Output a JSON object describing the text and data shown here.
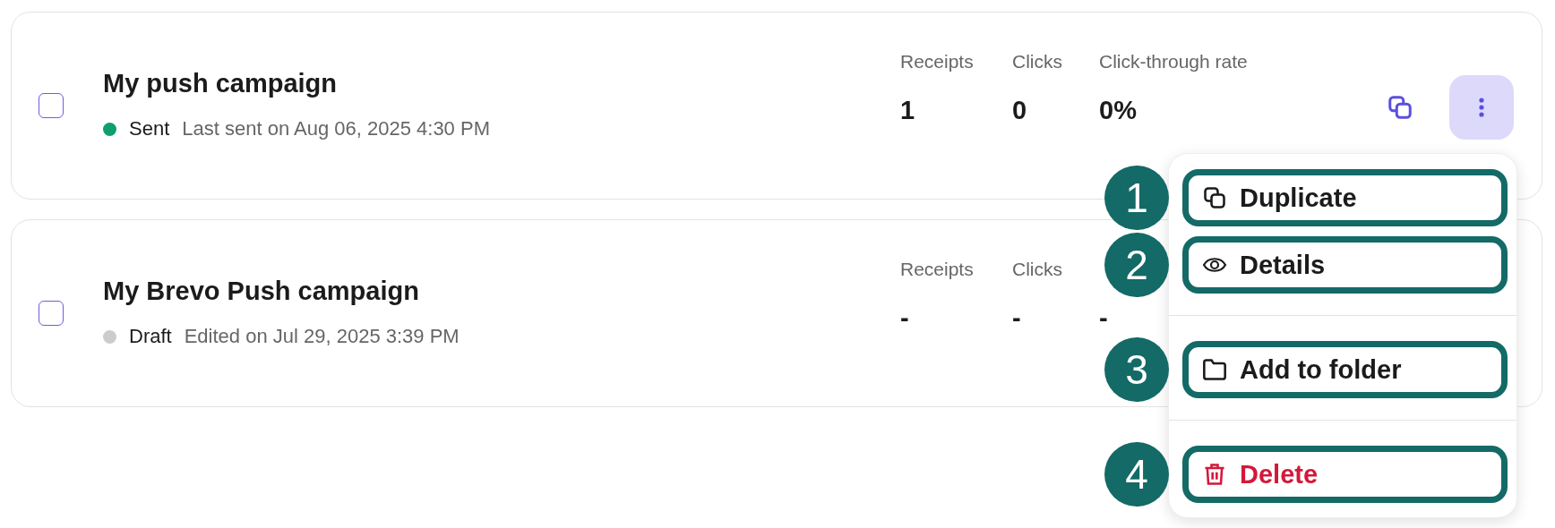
{
  "campaigns": [
    {
      "title": "My push campaign",
      "checked": false,
      "status": "Sent",
      "color": "#0e9f6e",
      "meta": "Last sent on Aug 06, 2025 4:30 PM",
      "stats": [
        {
          "label": "Receipts",
          "value": "1"
        },
        {
          "label": "Clicks",
          "value": "0"
        },
        {
          "label": "Click-through rate",
          "value": "0%"
        }
      ],
      "actions": true,
      "menu_open": true
    },
    {
      "title": "My Brevo Push campaign",
      "checked": false,
      "status": "Draft",
      "color": "#cccccc",
      "meta": "Edited on Jul 29, 2025 3:39 PM",
      "stats": [
        {
          "label": "Receipts",
          "value": "-"
        },
        {
          "label": "Clicks",
          "value": "-"
        },
        {
          "value": "-"
        }
      ],
      "actions": false
    }
  ],
  "menu_groups": [
    [
      {
        "kind": "duplicate",
        "label": "Duplicate",
        "callout": "1"
      },
      {
        "kind": "details",
        "label": "Details",
        "callout": "2"
      }
    ],
    [
      {
        "kind": "folder",
        "label": "Add to folder",
        "callout": "3"
      }
    ],
    [
      {
        "kind": "delete",
        "label": "Delete",
        "callout": "4"
      }
    ]
  ]
}
